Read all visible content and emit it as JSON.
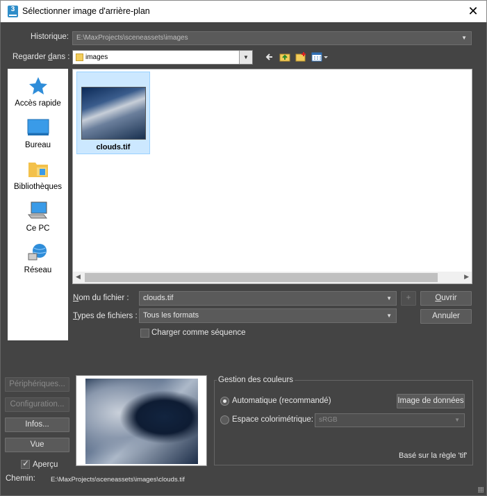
{
  "window": {
    "title": "Sélectionner image d'arrière-plan",
    "app_icon_text": "3",
    "close_glyph": "✕"
  },
  "history": {
    "label": "Historique:",
    "value": "E:\\MaxProjects\\sceneassets\\images"
  },
  "look_in": {
    "label_pre": "Regarder ",
    "label_accel": "d",
    "label_post": "ans :",
    "value": "images"
  },
  "places": [
    {
      "label": "Accès rapide",
      "icon": "star-icon"
    },
    {
      "label": "Bureau",
      "icon": "desktop-icon"
    },
    {
      "label": "Bibliothèques",
      "icon": "libraries-icon"
    },
    {
      "label": "Ce PC",
      "icon": "computer-icon"
    },
    {
      "label": "Réseau",
      "icon": "network-icon"
    }
  ],
  "files": [
    {
      "name": "clouds.tif",
      "selected": true
    }
  ],
  "filename": {
    "label_accel": "N",
    "label_post": "om du fichier :",
    "value": "clouds.tif",
    "plus": "+"
  },
  "filetype": {
    "label_accel": "T",
    "label_post": "ypes de fichiers :",
    "value": "Tous les formats"
  },
  "sequence": {
    "label": "Charger comme séquence",
    "checked": false
  },
  "buttons": {
    "open_accel": "O",
    "open_post": "uvrir",
    "cancel": "Annuler"
  },
  "side_buttons": {
    "devices": "Périphériques...",
    "config": "Configuration...",
    "info": "Infos...",
    "view": "Vue"
  },
  "preview_check": {
    "label": "Aperçu",
    "checked": true
  },
  "path": {
    "label": "Chemin:",
    "value": "E:\\MaxProjects\\sceneassets\\images\\clouds.tif"
  },
  "color_management": {
    "title": "Gestion des couleurs",
    "auto_label": "Automatique (recommandé)",
    "data_image_button": "Image de données",
    "colorspace_label": "Espace colorimétrique:",
    "colorspace_value": "sRGB",
    "rule_text": "Basé sur la règle 'tif'",
    "selected": "auto"
  },
  "colors": {
    "background": "#444444",
    "field": "#5a5a5a",
    "selection": "#cce8ff",
    "accent": "#2f8dc9"
  }
}
